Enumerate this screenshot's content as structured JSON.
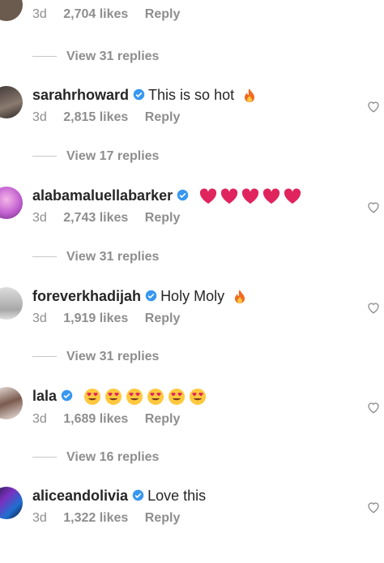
{
  "top": {
    "time": "3d",
    "likes": "2,704 likes",
    "reply": "Reply",
    "view_replies": "View 31 replies"
  },
  "comments": [
    {
      "username": "sarahrhoward",
      "text": "This is so hot",
      "emoji": "fire",
      "time": "3d",
      "likes": "2,815 likes",
      "reply": "Reply",
      "view_replies": "View 17 replies"
    },
    {
      "username": "alabamaluellabarker",
      "text": "",
      "emoji": "hearts5",
      "time": "3d",
      "likes": "2,743 likes",
      "reply": "Reply",
      "view_replies": "View 31 replies"
    },
    {
      "username": "foreverkhadijah",
      "text": "Holy Moly",
      "emoji": "fire",
      "time": "3d",
      "likes": "1,919 likes",
      "reply": "Reply",
      "view_replies": "View 31 replies"
    },
    {
      "username": "lala",
      "text": "",
      "emoji": "hearteyes6",
      "time": "3d",
      "likes": "1,689 likes",
      "reply": "Reply",
      "view_replies": "View 16 replies"
    },
    {
      "username": "aliceandolivia",
      "text": "Love this",
      "emoji": "",
      "time": "3d",
      "likes": "1,322 likes",
      "reply": "Reply"
    }
  ],
  "colors": {
    "verified": "#3897f0",
    "muted": "#8e8e8e",
    "heart": "#e0245e",
    "fire": "#f26b21"
  }
}
